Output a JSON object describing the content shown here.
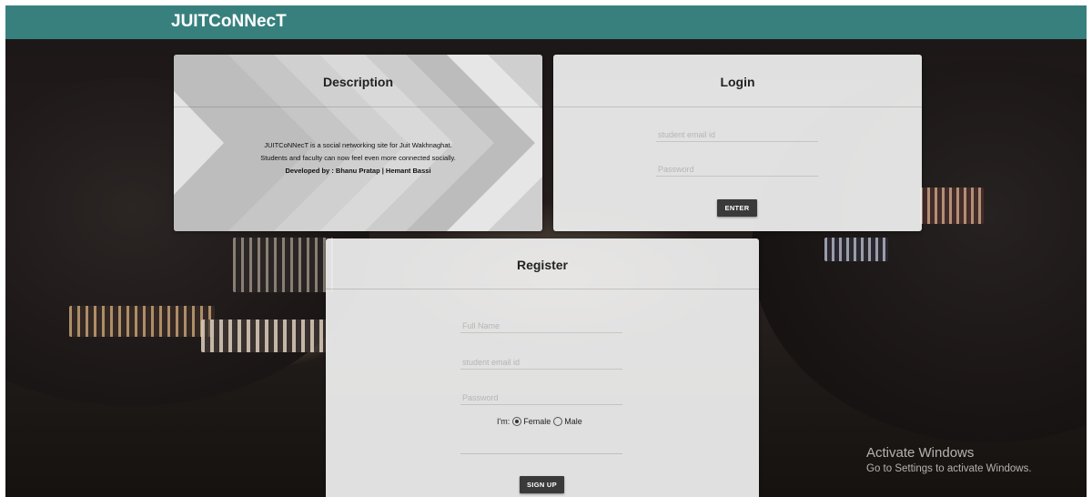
{
  "header": {
    "brand": "JUITCoNNecT"
  },
  "description": {
    "title": "Description",
    "line1": "JUITCoNNecT is a social networking site for Juit Wakhnaghat.",
    "line2": "Students and faculty can now feel even more connected socially.",
    "line3": "Developed by : Bhanu Pratap | Hemant Bassi"
  },
  "login": {
    "title": "Login",
    "email_placeholder": "student email id",
    "password_placeholder": "Password",
    "submit_label": "ENTER"
  },
  "register": {
    "title": "Register",
    "name_placeholder": "Full Name",
    "email_placeholder": "student email id",
    "password_placeholder": "Password",
    "gender_label": "I'm:",
    "gender_options": [
      "Female",
      "Male"
    ],
    "gender_selected": "Female",
    "submit_label": "SIGN UP"
  },
  "watermark": {
    "line1": "Activate Windows",
    "line2": "Go to Settings to activate Windows."
  },
  "colors": {
    "header": "#37807d",
    "button": "#3a3a3a"
  }
}
